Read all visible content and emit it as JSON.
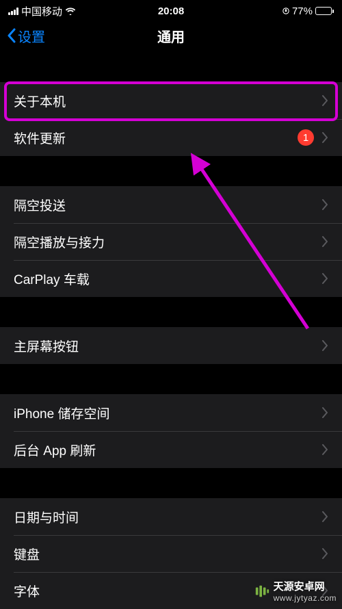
{
  "status_bar": {
    "carrier": "中国移动",
    "time": "20:08",
    "battery_pct": "77%"
  },
  "nav": {
    "back_label": "设置",
    "title": "通用"
  },
  "groups": [
    {
      "items": [
        {
          "label": "关于本机",
          "badge": null
        },
        {
          "label": "软件更新",
          "badge": "1"
        }
      ]
    },
    {
      "items": [
        {
          "label": "隔空投送",
          "badge": null
        },
        {
          "label": "隔空播放与接力",
          "badge": null
        },
        {
          "label": "CarPlay 车载",
          "badge": null
        }
      ]
    },
    {
      "items": [
        {
          "label": "主屏幕按钮",
          "badge": null
        }
      ]
    },
    {
      "items": [
        {
          "label": "iPhone 储存空间",
          "badge": null
        },
        {
          "label": "后台 App 刷新",
          "badge": null
        }
      ]
    },
    {
      "items": [
        {
          "label": "日期与时间",
          "badge": null
        },
        {
          "label": "键盘",
          "badge": null
        },
        {
          "label": "字体",
          "badge": null
        }
      ]
    }
  ],
  "annotation": {
    "highlight_color": "#d400d4",
    "arrow_color": "#d400d4"
  },
  "watermark": {
    "brand": "天源安卓网",
    "url": "www.jytyaz.com"
  }
}
